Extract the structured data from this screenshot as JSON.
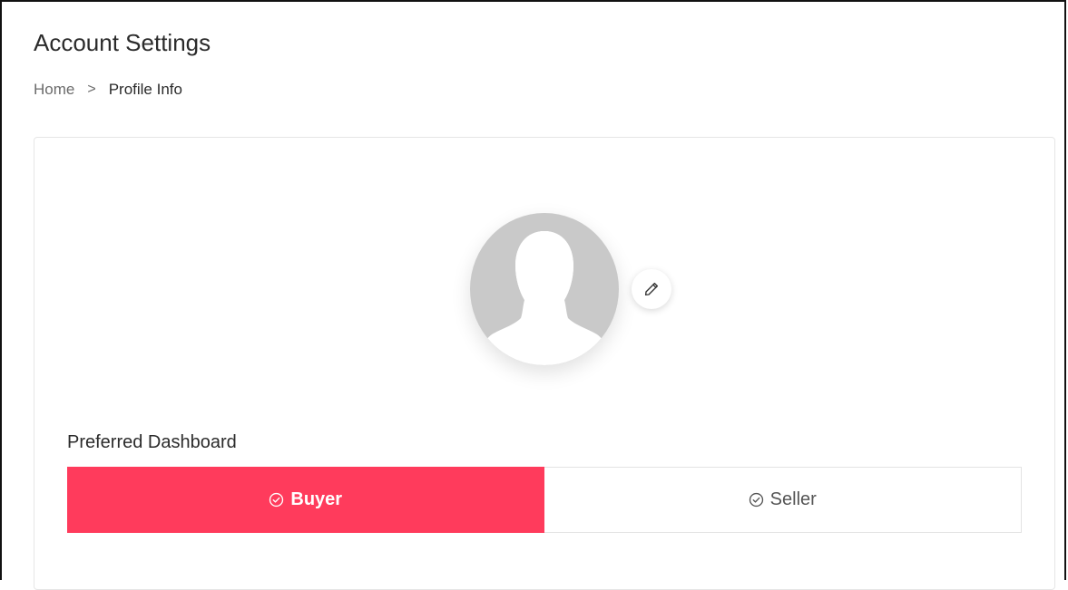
{
  "header": {
    "title": "Account Settings"
  },
  "breadcrumb": {
    "home": "Home",
    "separator": ">",
    "current": "Profile Info"
  },
  "profile": {
    "avatar_icon": "user-silhouette-icon",
    "edit_icon": "pencil-icon"
  },
  "preferred_dashboard": {
    "label": "Preferred Dashboard",
    "options": [
      {
        "label": "Buyer",
        "selected": true,
        "icon": "check-circle-icon"
      },
      {
        "label": "Seller",
        "selected": false,
        "icon": "check-circle-icon"
      }
    ]
  },
  "colors": {
    "accent": "#ff3b5c",
    "avatar_bg": "#c9c9c9"
  }
}
